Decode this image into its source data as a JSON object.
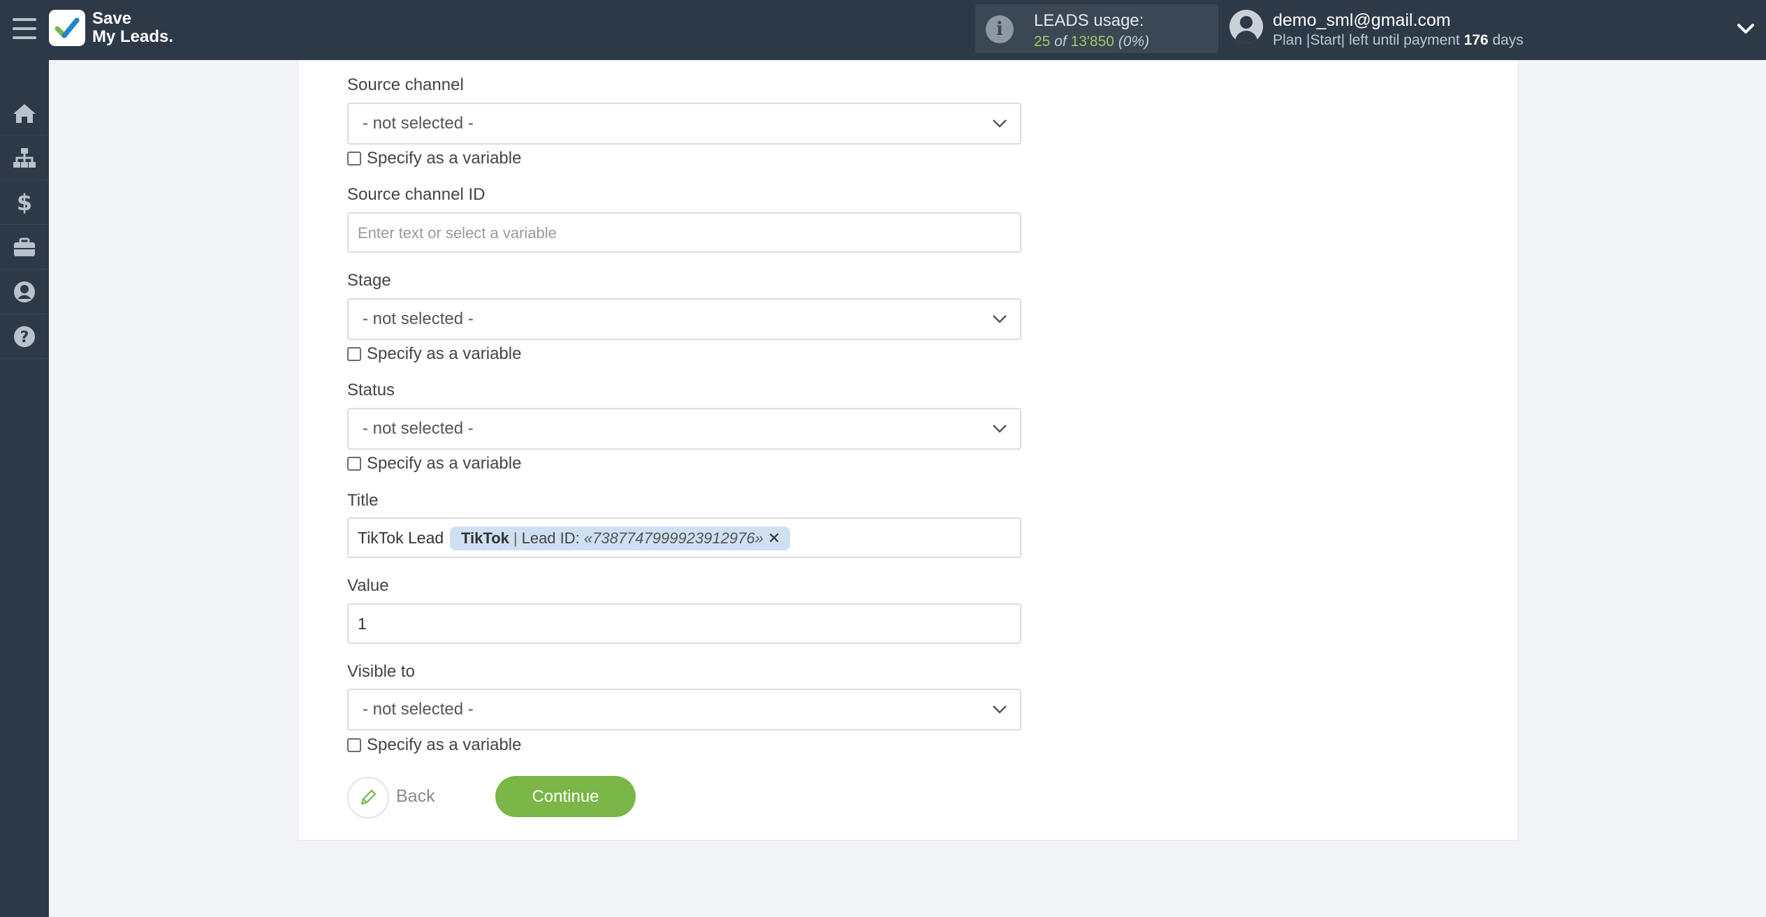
{
  "brand": {
    "line1": "Save",
    "line2": "My Leads."
  },
  "usage": {
    "label": "LEADS usage:",
    "used": "25",
    "of": "of",
    "total": "13'850",
    "percent": "(0%)"
  },
  "user": {
    "email": "demo_sml@gmail.com",
    "plan_prefix": "Plan |Start| left until payment",
    "days": "176",
    "days_suffix": "days"
  },
  "sidebar": {
    "icons": [
      "home-icon",
      "sitemap-icon",
      "dollar-icon",
      "briefcase-icon",
      "user-circle-icon",
      "help-icon"
    ]
  },
  "form": {
    "source_channel": {
      "label": "Source channel",
      "value": "- not selected -",
      "checkbox": "Specify as a variable"
    },
    "source_channel_id": {
      "label": "Source channel ID",
      "placeholder": "Enter text or select a variable"
    },
    "stage": {
      "label": "Stage",
      "value": "- not selected -",
      "checkbox": "Specify as a variable"
    },
    "status": {
      "label": "Status",
      "value": "- not selected -",
      "checkbox": "Specify as a variable"
    },
    "title": {
      "label": "Title",
      "text": "TikTok Lead",
      "tag_source": "TikTok",
      "tag_sep": "|",
      "tag_field": "Lead ID:",
      "tag_value": "«7387747999923912976»",
      "tag_remove": "✕"
    },
    "value": {
      "label": "Value",
      "value": "1"
    },
    "visible_to": {
      "label": "Visible to",
      "value": "- not selected -",
      "checkbox": "Specify as a variable"
    }
  },
  "actions": {
    "back": "Back",
    "continue": "Continue"
  }
}
